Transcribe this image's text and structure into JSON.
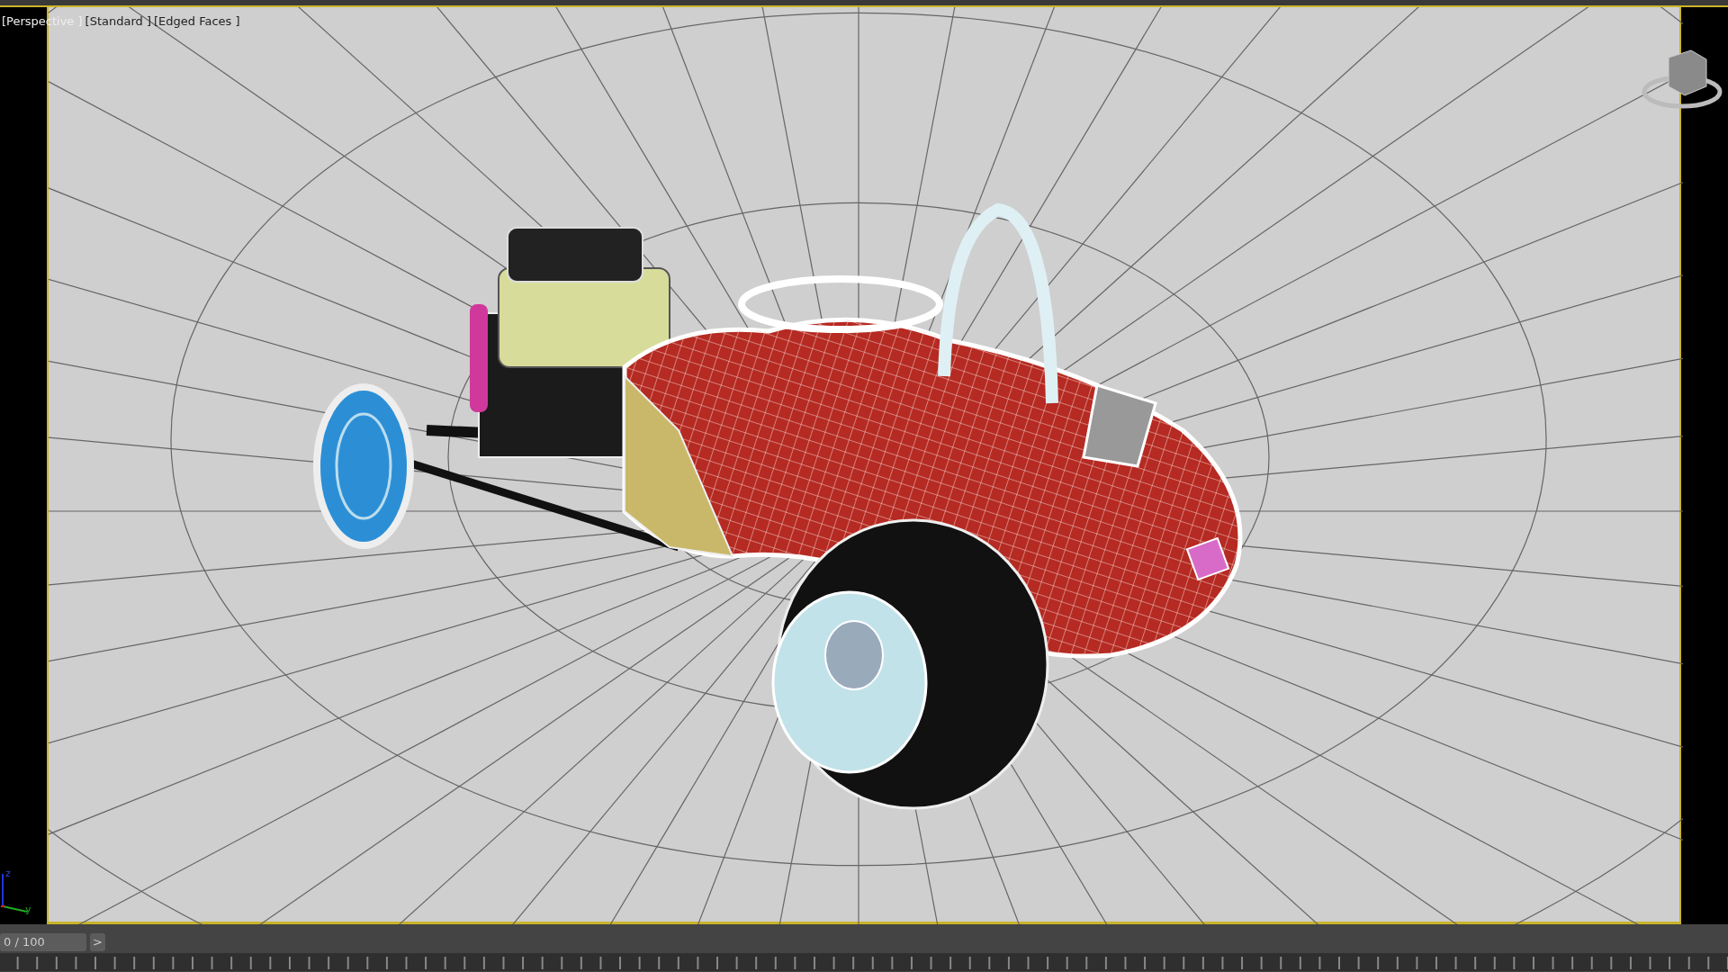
{
  "viewport": {
    "labels": [
      "[Perspective ]",
      "[Standard ]",
      "[Edged Faces ]"
    ],
    "axis_labels": [
      "z",
      "y"
    ]
  },
  "timeline": {
    "frame_display": "0 / 100",
    "next_button": ">",
    "level": 0
  }
}
